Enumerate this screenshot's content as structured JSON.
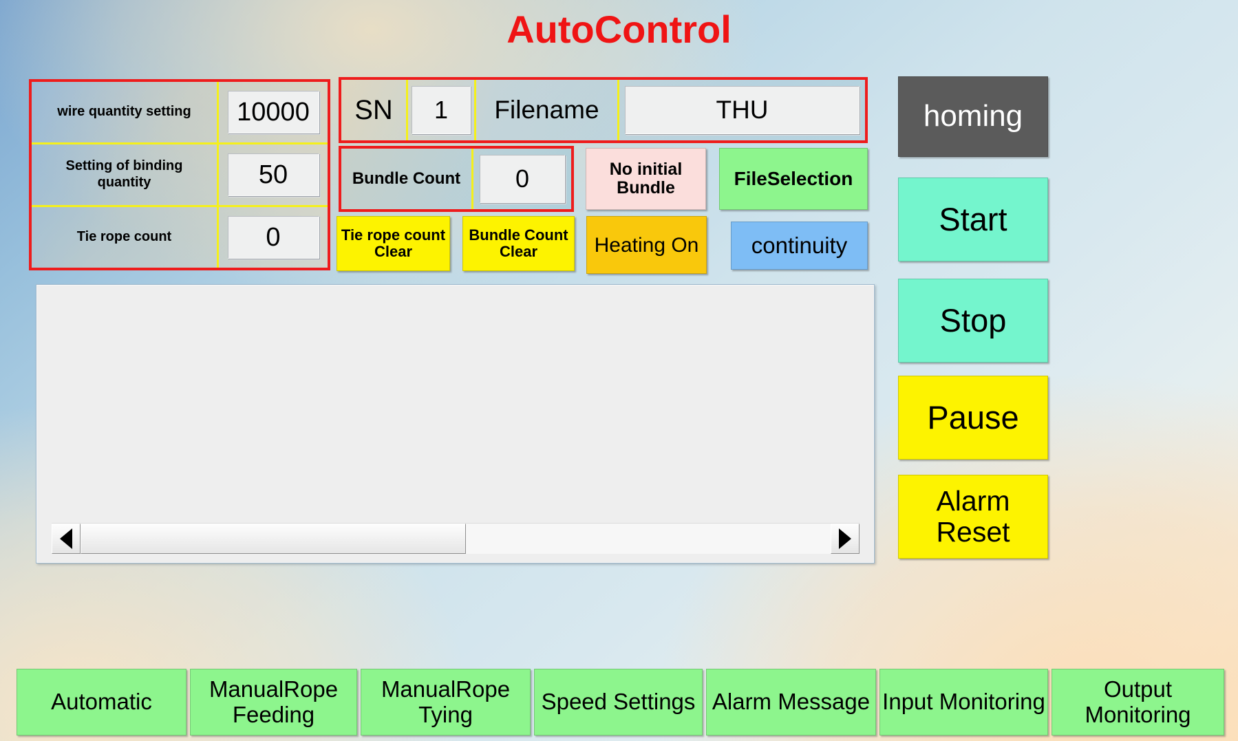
{
  "app": {
    "title": "AutoControl",
    "title_color": "#ef1414"
  },
  "settings_panel": {
    "border_color": "#ee1c1c",
    "divider_color": "#f5f01a",
    "rows": [
      {
        "label": "wire quantity setting",
        "value": "10000"
      },
      {
        "label": "Setting of binding quantity",
        "value": "50"
      },
      {
        "label": "Tie rope count",
        "value": "0"
      }
    ]
  },
  "sn_panel": {
    "border_color": "#ee1c1c",
    "sn_label": "SN",
    "sn_value": "1",
    "filename_label": "Filename",
    "filename_value": "THU"
  },
  "bundle_panel": {
    "border_color": "#ee1c1c",
    "label": "Bundle Count",
    "value": "0"
  },
  "action_buttons": {
    "no_initial_bundle": {
      "label": "No initial Bundle",
      "color": "#fbdedc"
    },
    "file_selection": {
      "label": "FileSelection",
      "color": "#8df58d"
    },
    "tie_rope_count_clear": {
      "label": "Tie rope count Clear",
      "color": "#fdf300"
    },
    "bundle_count_clear": {
      "label": "Bundle Count Clear",
      "color": "#fdf300"
    },
    "heating_on": {
      "label": "Heating On",
      "color": "#f9c80c"
    },
    "continuity": {
      "label": "continuity",
      "color": "#7ebdf5"
    }
  },
  "control_buttons": [
    {
      "label": "homing",
      "color": "#5b5b5b",
      "text_color": "#ffffff"
    },
    {
      "label": "Start",
      "color": "#74f5cd",
      "text_color": "#000000"
    },
    {
      "label": "Stop",
      "color": "#74f5cd",
      "text_color": "#000000"
    },
    {
      "label": "Pause",
      "color": "#fdf300",
      "text_color": "#000000"
    },
    {
      "label": "Alarm Reset",
      "color": "#fdf300",
      "text_color": "#000000"
    }
  ],
  "content": {
    "rows": [],
    "scrollbar": {
      "left_arrow_icon": "triangle-left-icon",
      "right_arrow_icon": "triangle-right-icon"
    }
  },
  "tabs": [
    {
      "label": "Automatic",
      "color": "#8df58d"
    },
    {
      "label": "ManualRope Feeding",
      "color": "#8df58d"
    },
    {
      "label": "ManualRope Tying",
      "color": "#8df58d"
    },
    {
      "label": "Speed Settings",
      "color": "#8df58d"
    },
    {
      "label": "Alarm Message",
      "color": "#8df58d"
    },
    {
      "label": "Input Monitoring",
      "color": "#8df58d"
    },
    {
      "label": "Output Monitoring",
      "color": "#8df58d"
    }
  ]
}
